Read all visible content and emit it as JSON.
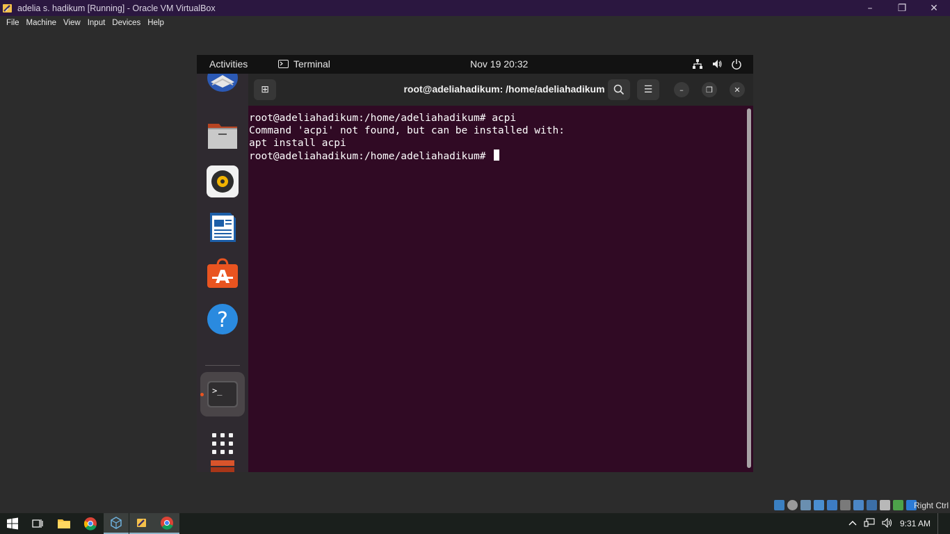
{
  "host_window": {
    "title": "adelia s. hadikum [Running] - Oracle VM VirtualBox",
    "controls": {
      "minimize": "–",
      "restore": "❐",
      "close": "✕"
    }
  },
  "menubar": {
    "items": [
      {
        "label": "File"
      },
      {
        "label": "Machine"
      },
      {
        "label": "View"
      },
      {
        "label": "Input"
      },
      {
        "label": "Devices"
      },
      {
        "label": "Help"
      }
    ]
  },
  "guest_topbar": {
    "activities": "Activities",
    "app_name": "Terminal",
    "clock": "Nov 19  20:32",
    "tray_icons": [
      "network-icon",
      "volume-icon",
      "power-icon"
    ]
  },
  "dock": {
    "apps": [
      {
        "name": "thunderbird-icon"
      },
      {
        "name": "files-icon"
      },
      {
        "name": "rhythmbox-icon"
      },
      {
        "name": "libreoffice-writer-icon"
      },
      {
        "name": "ubuntu-software-icon"
      },
      {
        "name": "help-icon",
        "glyph": "?"
      },
      {
        "name": "terminal-icon",
        "glyph": ">_"
      },
      {
        "name": "disk-app-icon"
      },
      {
        "name": "show-applications-icon"
      }
    ]
  },
  "terminal": {
    "title": "root@adeliahadikum: /home/adeliahadikum",
    "lines": [
      "root@adeliahadikum:/home/adeliahadikum# acpi",
      "Command 'acpi' not found, but can be installed with:",
      "apt install acpi",
      "root@adeliahadikum:/home/adeliahadikum# "
    ],
    "header_buttons": {
      "new_tab": "⊞",
      "search": "⌕",
      "menu": "☰",
      "minimize": "–",
      "maximize": "❐",
      "close": "✕"
    },
    "colors": {
      "background": "#300a24",
      "header": "#272727"
    }
  },
  "vb_status": {
    "host_key": "Right Ctrl"
  },
  "taskbar": {
    "time": "9:31 AM",
    "apps": [
      "start-icon",
      "task-view-icon",
      "file-explorer-icon",
      "chrome-icon",
      "virtualbox-manager-icon",
      "virtualbox-vm-icon",
      "chrome-active-icon"
    ]
  }
}
